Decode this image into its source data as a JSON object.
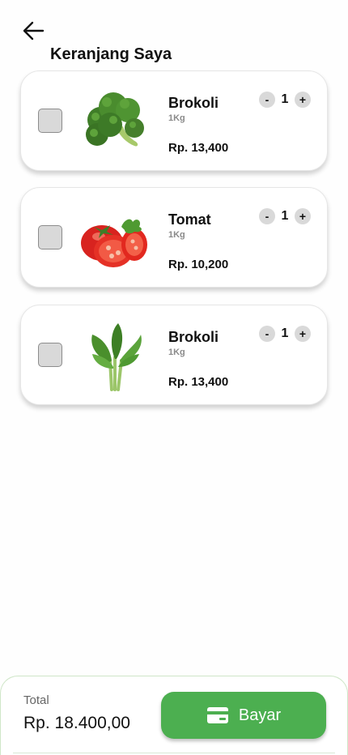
{
  "header": {
    "title": "Keranjang Saya",
    "back_icon": "arrow-left-icon"
  },
  "cart": {
    "items": [
      {
        "name": "Brokoli",
        "weight": "1Kg",
        "price": "Rp. 13,400",
        "qty": "1",
        "minus": "-",
        "plus": "+",
        "image": "broccoli-image"
      },
      {
        "name": "Tomat",
        "weight": "1Kg",
        "price": "Rp. 10,200",
        "qty": "1",
        "minus": "-",
        "plus": "+",
        "image": "tomato-image"
      },
      {
        "name": "Brokoli",
        "weight": "1Kg",
        "price": "Rp. 13,400",
        "qty": "1",
        "minus": "-",
        "plus": "+",
        "image": "leafy-greens-image"
      }
    ]
  },
  "footer": {
    "total_label": "Total",
    "total_value": "Rp. 18.400,00",
    "pay_label": "Bayar",
    "pay_icon": "wallet-card-icon"
  },
  "colors": {
    "accent": "#4caf50",
    "checkbox": "#d9d9d9",
    "qty_button": "#d9d9d9"
  }
}
